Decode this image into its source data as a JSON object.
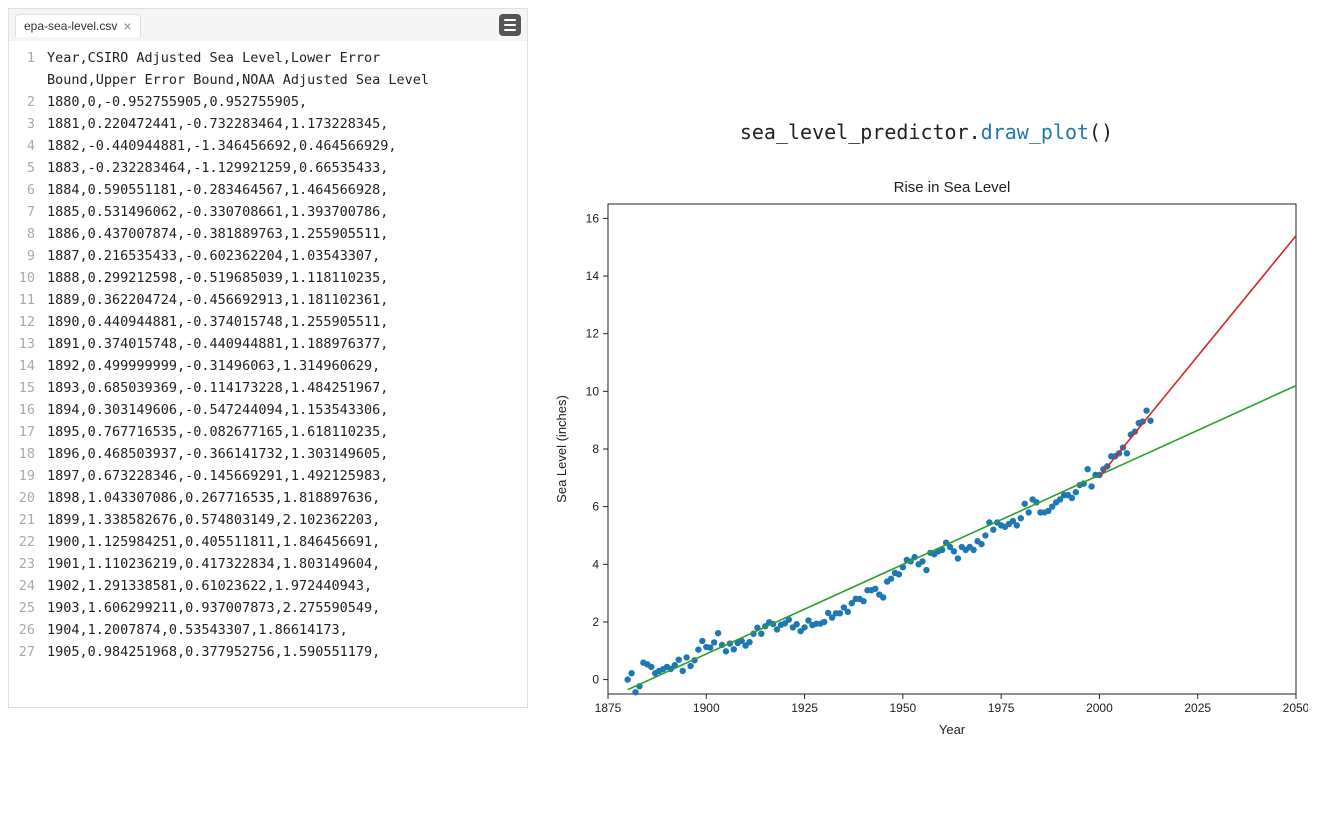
{
  "tab": {
    "filename": "epa-sea-level.csv"
  },
  "csv": {
    "header": "Year,CSIRO Adjusted Sea Level,Lower Error Bound,Upper Error Bound,NOAA Adjusted Sea Level",
    "rows": [
      "1880,0,-0.952755905,0.952755905,",
      "1881,0.220472441,-0.732283464,1.173228345,",
      "1882,-0.440944881,-1.346456692,0.464566929,",
      "1883,-0.232283464,-1.129921259,0.66535433,",
      "1884,0.590551181,-0.283464567,1.464566928,",
      "1885,0.531496062,-0.330708661,1.393700786,",
      "1886,0.437007874,-0.381889763,1.255905511,",
      "1887,0.216535433,-0.602362204,1.03543307,",
      "1888,0.299212598,-0.519685039,1.118110235,",
      "1889,0.362204724,-0.456692913,1.181102361,",
      "1890,0.440944881,-0.374015748,1.255905511,",
      "1891,0.374015748,-0.440944881,1.188976377,",
      "1892,0.499999999,-0.31496063,1.314960629,",
      "1893,0.685039369,-0.114173228,1.484251967,",
      "1894,0.303149606,-0.547244094,1.153543306,",
      "1895,0.767716535,-0.082677165,1.618110235,",
      "1896,0.468503937,-0.366141732,1.303149605,",
      "1897,0.673228346,-0.145669291,1.492125983,",
      "1898,1.043307086,0.267716535,1.818897636,",
      "1899,1.338582676,0.574803149,2.102362203,",
      "1900,1.125984251,0.405511811,1.846456691,",
      "1901,1.110236219,0.417322834,1.803149604,",
      "1902,1.291338581,0.61023622,1.972440943,",
      "1903,1.606299211,0.937007873,2.275590549,",
      "1904,1.2007874,0.53543307,1.86614173,",
      "1905,0.984251968,0.377952756,1.590551179,"
    ]
  },
  "code_cell": {
    "module": "sea_level_predictor",
    "method": "draw_plot",
    "suffix": "()"
  },
  "chart_data": {
    "type": "scatter+line",
    "title": "Rise in Sea Level",
    "xlabel": "Year",
    "ylabel": "Sea Level (inches)",
    "xlim": [
      1875,
      2050
    ],
    "ylim": [
      -0.5,
      16.5
    ],
    "xticks": [
      1875,
      1900,
      1925,
      1950,
      1975,
      2000,
      2025,
      2050
    ],
    "yticks": [
      0,
      2,
      4,
      6,
      8,
      10,
      12,
      14,
      16
    ],
    "scatter": {
      "x": [
        1880,
        1881,
        1882,
        1883,
        1884,
        1885,
        1886,
        1887,
        1888,
        1889,
        1890,
        1891,
        1892,
        1893,
        1894,
        1895,
        1896,
        1897,
        1898,
        1899,
        1900,
        1901,
        1902,
        1903,
        1904,
        1905,
        1906,
        1907,
        1908,
        1909,
        1910,
        1911,
        1912,
        1913,
        1914,
        1915,
        1916,
        1917,
        1918,
        1919,
        1920,
        1921,
        1922,
        1923,
        1924,
        1925,
        1926,
        1927,
        1928,
        1929,
        1930,
        1931,
        1932,
        1933,
        1934,
        1935,
        1936,
        1937,
        1938,
        1939,
        1940,
        1941,
        1942,
        1943,
        1944,
        1945,
        1946,
        1947,
        1948,
        1949,
        1950,
        1951,
        1952,
        1953,
        1954,
        1955,
        1956,
        1957,
        1958,
        1959,
        1960,
        1961,
        1962,
        1963,
        1964,
        1965,
        1966,
        1967,
        1968,
        1969,
        1970,
        1971,
        1972,
        1973,
        1974,
        1975,
        1976,
        1977,
        1978,
        1979,
        1980,
        1981,
        1982,
        1983,
        1984,
        1985,
        1986,
        1987,
        1988,
        1989,
        1990,
        1991,
        1992,
        1993,
        1994,
        1995,
        1996,
        1997,
        1998,
        1999,
        2000,
        2001,
        2002,
        2003,
        2004,
        2005,
        2006,
        2007,
        2008,
        2009,
        2010,
        2011,
        2012,
        2013
      ],
      "y": [
        0,
        0.22,
        -0.44,
        -0.23,
        0.59,
        0.53,
        0.44,
        0.22,
        0.3,
        0.36,
        0.44,
        0.37,
        0.5,
        0.69,
        0.3,
        0.77,
        0.47,
        0.67,
        1.04,
        1.34,
        1.13,
        1.11,
        1.29,
        1.61,
        1.2,
        0.98,
        1.25,
        1.05,
        1.27,
        1.34,
        1.18,
        1.3,
        1.59,
        1.8,
        1.59,
        1.85,
        1.99,
        1.93,
        1.74,
        1.9,
        1.95,
        2.08,
        1.81,
        1.92,
        1.68,
        1.81,
        2.05,
        1.89,
        1.94,
        1.94,
        2.0,
        2.31,
        2.15,
        2.3,
        2.3,
        2.5,
        2.35,
        2.65,
        2.8,
        2.8,
        2.72,
        3.1,
        3.1,
        3.15,
        2.95,
        2.85,
        3.4,
        3.5,
        3.7,
        3.65,
        3.9,
        4.15,
        4.1,
        4.25,
        4.0,
        4.1,
        3.8,
        4.4,
        4.35,
        4.45,
        4.5,
        4.75,
        4.6,
        4.45,
        4.2,
        4.6,
        4.5,
        4.6,
        4.5,
        4.8,
        4.7,
        5.0,
        5.45,
        5.2,
        5.45,
        5.35,
        5.3,
        5.4,
        5.5,
        5.35,
        5.6,
        6.1,
        5.8,
        6.25,
        6.15,
        5.8,
        5.8,
        5.85,
        6.0,
        6.15,
        6.25,
        6.4,
        6.4,
        6.3,
        6.5,
        6.75,
        6.8,
        7.3,
        6.7,
        7.1,
        7.1,
        7.3,
        7.4,
        7.75,
        7.75,
        7.85,
        8.05,
        7.85,
        8.5,
        8.6,
        8.9,
        8.95,
        9.33,
        8.98
      ],
      "color": "#1f77b4"
    },
    "lines": [
      {
        "name": "fit_all",
        "color": "#2ca02c",
        "x": [
          1880,
          2050
        ],
        "y": [
          -0.35,
          10.2
        ]
      },
      {
        "name": "fit_2000",
        "color": "#d62728",
        "x": [
          2000,
          2050
        ],
        "y": [
          7.05,
          15.4
        ]
      }
    ]
  }
}
